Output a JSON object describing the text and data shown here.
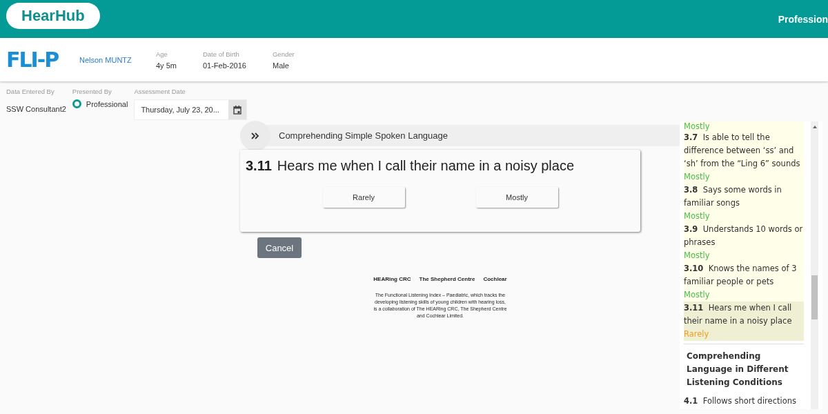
{
  "header": {
    "brand": "HearHub",
    "menu_item": "Profession"
  },
  "patient": {
    "logo": "FLI-P",
    "name": "Nelson MUNTZ",
    "fields": [
      {
        "label": "Age",
        "value": "4y 5m"
      },
      {
        "label": "Date of Birth",
        "value": "01-Feb-2016"
      },
      {
        "label": "Gender",
        "value": "Male"
      }
    ]
  },
  "form": {
    "data_entered_by": {
      "label": "Data Entered By",
      "value": "SSW Consultant2"
    },
    "presented_by": {
      "label": "Presented By",
      "options": [
        {
          "label": "Professional",
          "selected": true
        }
      ]
    },
    "assessment_date": {
      "label": "Assessment Date",
      "value": "Thursday, July 23, 20..."
    }
  },
  "section": {
    "title": "Comprehending Simple Spoken Language"
  },
  "question": {
    "number": "3.11",
    "text": "Hears me when I call their name in a noisy place",
    "answers": [
      {
        "label": "Rarely",
        "selected": false
      },
      {
        "label": "Mostly",
        "selected": false
      }
    ]
  },
  "cancel_button": "Cancel",
  "footer": {
    "logos": [
      "HEARing CRC",
      "The Shepherd Centre",
      "Cochlear"
    ],
    "text": "The Functional Listening Index – Paediatric, which tracks the developing listening skills of young children with hearing loss, is a collaboration of The HEARing CRC, The Shepherd Centre and Cochlear Limited."
  },
  "sidebar": {
    "top_answer": {
      "label": "Mostly",
      "kind": "mostly"
    },
    "items": [
      {
        "number": "3.7",
        "text": "Is able to tell the difference between ‘ss’ and ‘sh’ from the “Ling 6” sounds",
        "answer": "Mostly",
        "kind": "mostly",
        "selected": false
      },
      {
        "number": "3.8",
        "text": "Says some words in familiar songs",
        "answer": "Mostly",
        "kind": "mostly",
        "selected": false
      },
      {
        "number": "3.9",
        "text": "Understands 10 words or phrases",
        "answer": "Mostly",
        "kind": "mostly",
        "selected": false
      },
      {
        "number": "3.10",
        "text": "Knows the names of 3 familiar people or pets",
        "answer": "Mostly",
        "kind": "mostly",
        "selected": false
      },
      {
        "number": "3.11",
        "text": "Hears me when I call their name in a noisy place",
        "answer": "Rarely",
        "kind": "rarely",
        "selected": true
      }
    ],
    "next_section": "Comprehending Language in Different Listening Conditions",
    "next_item": {
      "number": "4.1",
      "text": "Follows short directions"
    }
  }
}
